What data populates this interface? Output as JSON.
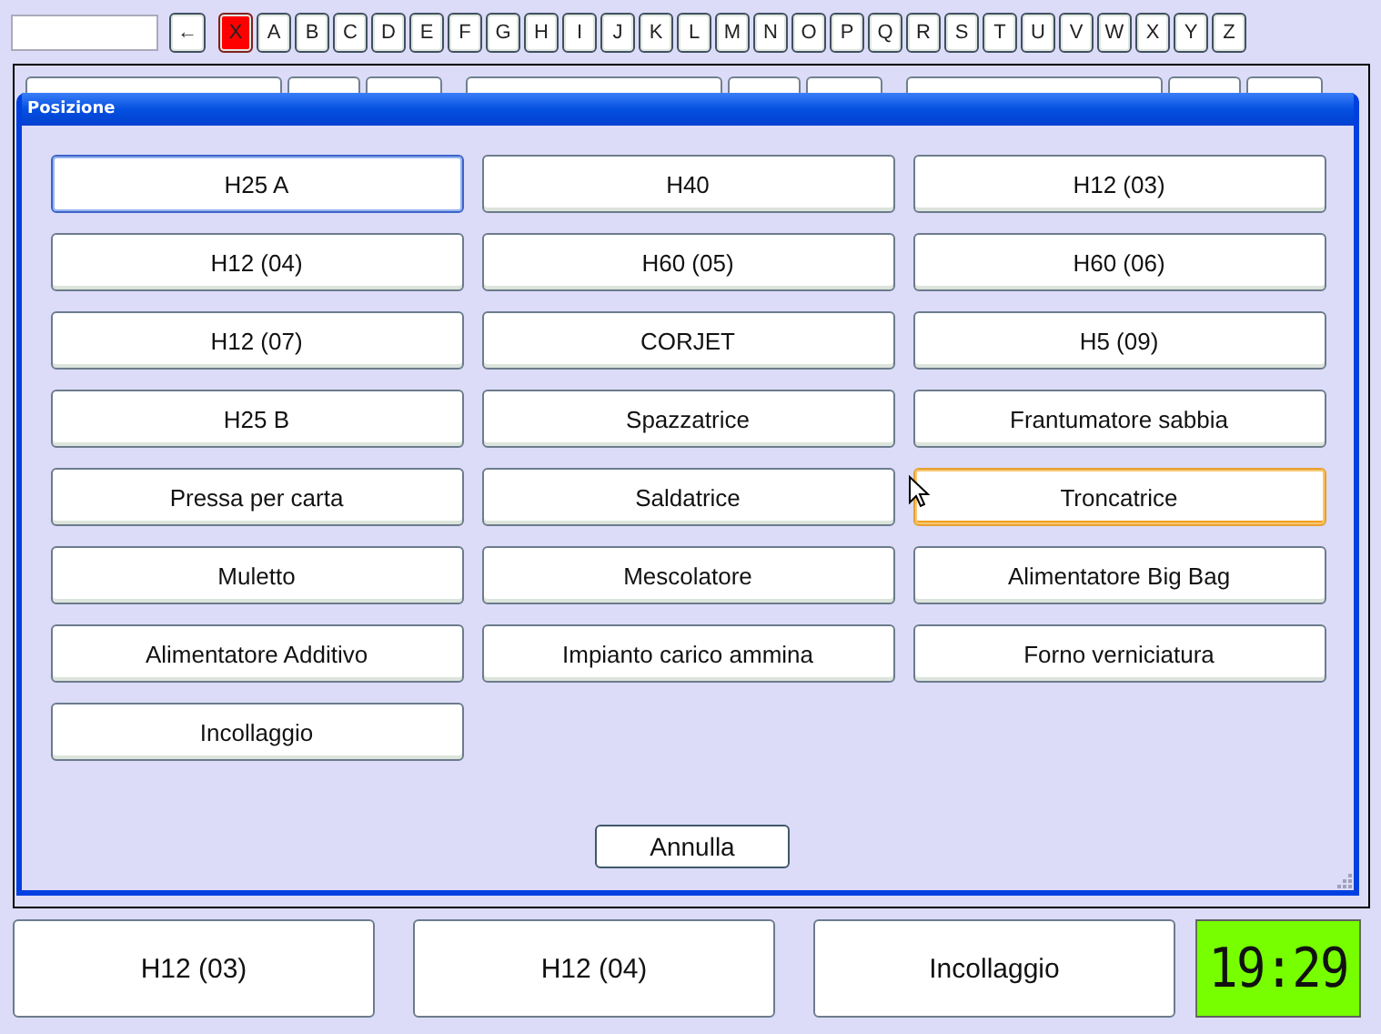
{
  "keys": [
    {
      "label": "←",
      "kind": "back"
    },
    {
      "label": "X",
      "kind": "clear"
    },
    {
      "label": "A",
      "kind": "letter"
    },
    {
      "label": "B",
      "kind": "letter"
    },
    {
      "label": "C",
      "kind": "letter"
    },
    {
      "label": "D",
      "kind": "letter"
    },
    {
      "label": "E",
      "kind": "letter"
    },
    {
      "label": "F",
      "kind": "letter"
    },
    {
      "label": "G",
      "kind": "letter"
    },
    {
      "label": "H",
      "kind": "letter"
    },
    {
      "label": "I",
      "kind": "letter"
    },
    {
      "label": "J",
      "kind": "letter"
    },
    {
      "label": "K",
      "kind": "letter"
    },
    {
      "label": "L",
      "kind": "letter"
    },
    {
      "label": "M",
      "kind": "letter"
    },
    {
      "label": "N",
      "kind": "letter"
    },
    {
      "label": "O",
      "kind": "letter"
    },
    {
      "label": "P",
      "kind": "letter"
    },
    {
      "label": "Q",
      "kind": "letter"
    },
    {
      "label": "R",
      "kind": "letter"
    },
    {
      "label": "S",
      "kind": "letter"
    },
    {
      "label": "T",
      "kind": "letter"
    },
    {
      "label": "U",
      "kind": "letter"
    },
    {
      "label": "V",
      "kind": "letter"
    },
    {
      "label": "W",
      "kind": "letter"
    },
    {
      "label": "X",
      "kind": "letter"
    },
    {
      "label": "Y",
      "kind": "letter"
    },
    {
      "label": "Z",
      "kind": "letter"
    }
  ],
  "dialog": {
    "title": "Posizione",
    "options": [
      {
        "label": "H25 A",
        "focused": true,
        "hovered": false
      },
      {
        "label": "H40",
        "focused": false,
        "hovered": false
      },
      {
        "label": "H12 (03)",
        "focused": false,
        "hovered": false
      },
      {
        "label": "H12 (04)",
        "focused": false,
        "hovered": false
      },
      {
        "label": "H60 (05)",
        "focused": false,
        "hovered": false
      },
      {
        "label": "H60 (06)",
        "focused": false,
        "hovered": false
      },
      {
        "label": "H12 (07)",
        "focused": false,
        "hovered": false
      },
      {
        "label": "CORJET",
        "focused": false,
        "hovered": false
      },
      {
        "label": "H5 (09)",
        "focused": false,
        "hovered": false
      },
      {
        "label": "H25 B",
        "focused": false,
        "hovered": false
      },
      {
        "label": "Spazzatrice",
        "focused": false,
        "hovered": false
      },
      {
        "label": "Frantumatore sabbia",
        "focused": false,
        "hovered": false
      },
      {
        "label": "Pressa per carta",
        "focused": false,
        "hovered": false
      },
      {
        "label": "Saldatrice",
        "focused": false,
        "hovered": false
      },
      {
        "label": "Troncatrice",
        "focused": false,
        "hovered": true
      },
      {
        "label": "Muletto",
        "focused": false,
        "hovered": false
      },
      {
        "label": "Mescolatore",
        "focused": false,
        "hovered": false
      },
      {
        "label": "Alimentatore Big Bag",
        "focused": false,
        "hovered": false
      },
      {
        "label": "Alimentatore Additivo",
        "focused": false,
        "hovered": false
      },
      {
        "label": "Impianto carico ammina",
        "focused": false,
        "hovered": false
      },
      {
        "label": "Forno verniciatura",
        "focused": false,
        "hovered": false
      },
      {
        "label": "Incollaggio",
        "focused": false,
        "hovered": false
      }
    ],
    "cancel": "Annulla"
  },
  "bottom_bar": {
    "buttons": [
      "H12 (03)",
      "H12 (04)",
      "Incollaggio"
    ],
    "clock": "19:29"
  }
}
